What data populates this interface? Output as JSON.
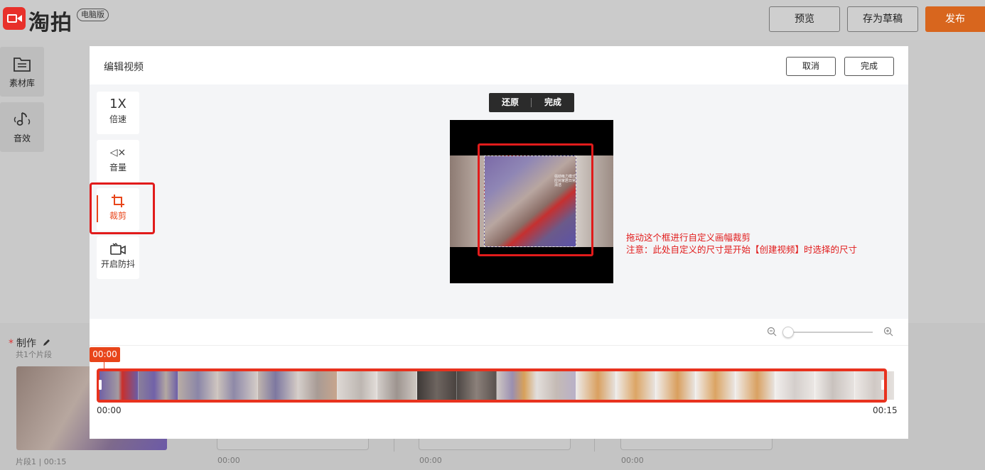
{
  "app": {
    "name": "淘拍",
    "edition": "电脑版"
  },
  "header_actions": {
    "preview": "预览",
    "save_draft": "存为草稿",
    "publish": "发布"
  },
  "sidebar": {
    "items": [
      {
        "label": "素材库",
        "icon": "library-icon"
      },
      {
        "label": "音效",
        "icon": "music-note-icon"
      }
    ]
  },
  "production": {
    "title": "制作",
    "subtitle": "共1个片段",
    "clip_label": "片段1 | 00:15",
    "slot_times": [
      "00:00",
      "00:00",
      "00:00"
    ]
  },
  "modal": {
    "title": "编辑视频",
    "cancel": "取消",
    "done": "完成",
    "tools": [
      {
        "icon_text": "1X",
        "label": "倍速",
        "icon": "speed-icon",
        "active": false
      },
      {
        "icon_text": "◁×",
        "label": "音量",
        "icon": "volume-mute-icon",
        "active": false
      },
      {
        "icon_text": "",
        "label": "裁剪",
        "icon": "crop-icon",
        "active": true
      },
      {
        "icon_text": "",
        "label": "开启防抖",
        "icon": "stabilize-camera-icon",
        "active": false
      }
    ],
    "crop_toolbar": {
      "restore": "还原",
      "done": "完成"
    },
    "video_overlay_text": [
      "强劲吸力模式",
      "应对家居日常清洁"
    ],
    "annotation": {
      "line1": "拖动这个框进行自定义画幅裁剪",
      "line2": "注意：此处自定义的尺寸是开始【创建视频】时选择的尺寸"
    },
    "timeline": {
      "playhead": "00:00",
      "start": "00:00",
      "end": "00:15"
    }
  },
  "colors": {
    "accent": "#e8451a",
    "annotation_red": "#e11b1b",
    "publish": "#d8661e"
  }
}
